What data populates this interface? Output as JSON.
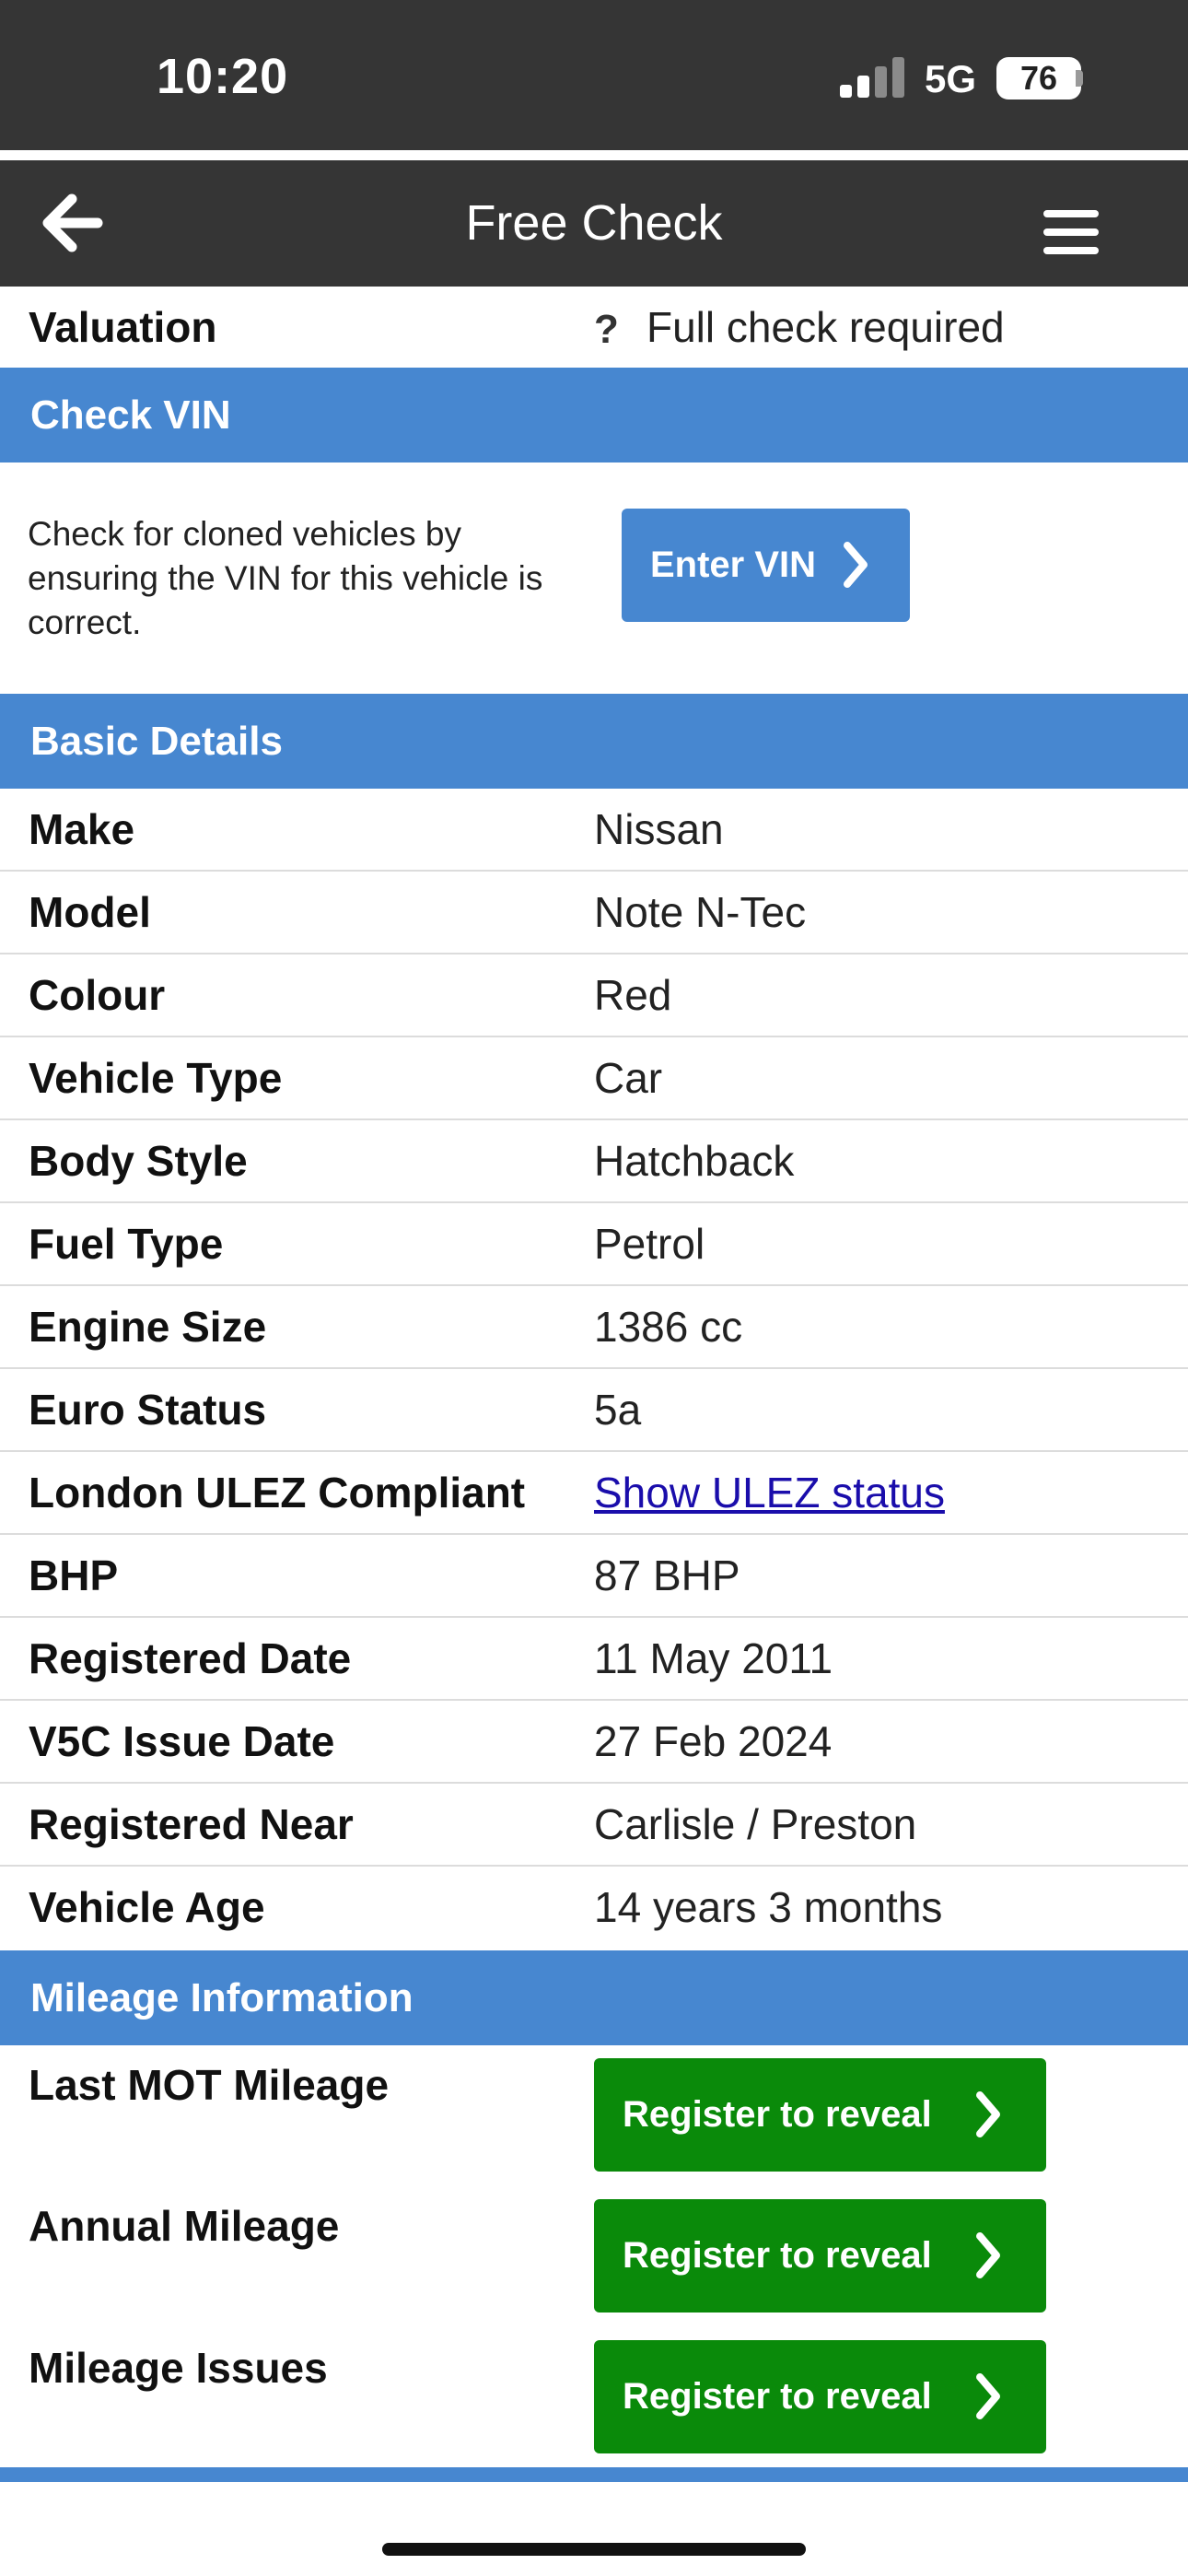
{
  "status_bar": {
    "time": "10:20",
    "network": "5G",
    "battery": "76"
  },
  "nav": {
    "title": "Free Check",
    "back_icon": "arrow-left-icon",
    "menu_icon": "hamburger-menu-icon"
  },
  "valuation": {
    "label": "Valuation",
    "help_symbol": "?",
    "value": "Full check required"
  },
  "check_vin": {
    "title": "Check VIN",
    "description": "Check for cloned vehicles by ensuring the VIN for this vehicle is correct.",
    "button_label": "Enter VIN"
  },
  "basic_details": {
    "title": "Basic Details",
    "rows": [
      {
        "label": "Make",
        "value": "Nissan"
      },
      {
        "label": "Model",
        "value": "Note N-Tec"
      },
      {
        "label": "Colour",
        "value": "Red"
      },
      {
        "label": "Vehicle Type",
        "value": "Car"
      },
      {
        "label": "Body Style",
        "value": "Hatchback"
      },
      {
        "label": "Fuel Type",
        "value": "Petrol"
      },
      {
        "label": "Engine Size",
        "value": "1386 cc"
      },
      {
        "label": "Euro Status",
        "value": "5a"
      },
      {
        "label": "London ULEZ Compliant",
        "value": "Show ULEZ status"
      },
      {
        "label": "BHP",
        "value": "87 BHP"
      },
      {
        "label": "Registered Date",
        "value": "11 May 2011"
      },
      {
        "label": "V5C Issue Date",
        "value": "27 Feb 2024"
      },
      {
        "label": "Registered Near",
        "value": "Carlisle / Preston"
      },
      {
        "label": "Vehicle Age",
        "value": "14 years 3 months"
      }
    ]
  },
  "mileage": {
    "title": "Mileage Information",
    "rows": [
      {
        "label": "Last MOT Mileage",
        "button": "Register to reveal"
      },
      {
        "label": "Annual Mileage",
        "button": "Register to reveal"
      },
      {
        "label": "Mileage Issues",
        "button": "Register to reveal"
      }
    ]
  },
  "colors": {
    "header_dark": "#353535",
    "section_blue": "#4787d0",
    "reveal_green": "#0a8a0a",
    "link_blue": "#1a0dab"
  }
}
